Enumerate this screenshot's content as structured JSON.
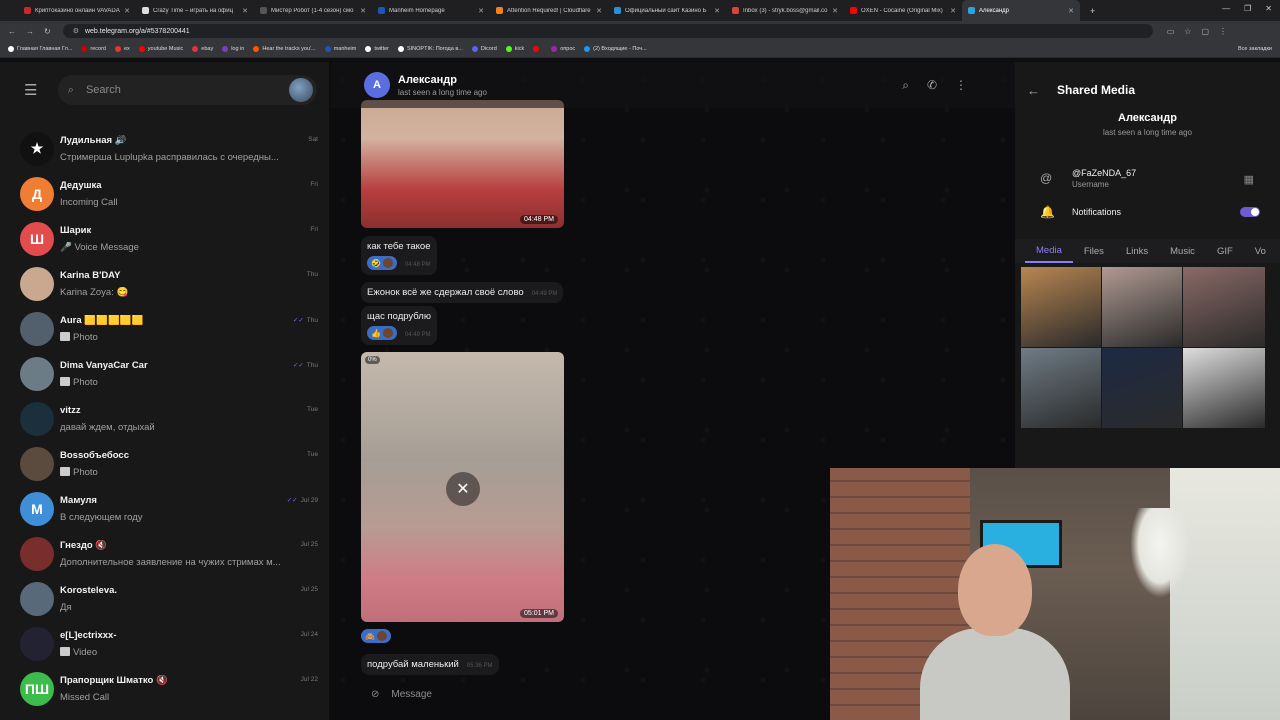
{
  "browser": {
    "tabs": [
      {
        "label": "Криптоказино онлайн VAVADA",
        "color": "#c82a2a"
      },
      {
        "label": "Crazy Time – играть на офиц",
        "color": "#ddd"
      },
      {
        "label": "Мистер Робот (1-4 сезон) смо",
        "color": "#555"
      },
      {
        "label": "Manheim Homepage",
        "color": "#1a57b8"
      },
      {
        "label": "Attention Required! | Cloudflare",
        "color": "#f48120"
      },
      {
        "label": "Официальный сайт Казино Б",
        "color": "#2c8fd6"
      },
      {
        "label": "Inbox (3) - stryk.boss@gmail.co",
        "color": "#d44638"
      },
      {
        "label": "OXEN - Cocaine (Original Mix)",
        "color": "#ff0000"
      },
      {
        "label": "Александр",
        "color": "#2aa3e0",
        "active": true
      }
    ],
    "url": "web.telegram.org/a/#5378200441",
    "bookmarks": [
      {
        "label": "Главная Главная Гл...",
        "color": "#fff"
      },
      {
        "label": "record",
        "color": "#c00"
      },
      {
        "label": "ex",
        "color": "#e33"
      },
      {
        "label": "youtube Music",
        "color": "#f00"
      },
      {
        "label": "ebay",
        "color": "#e53238"
      },
      {
        "label": "log in",
        "color": "#7b3fb8"
      },
      {
        "label": "Hear the tracks you'...",
        "color": "#f50"
      },
      {
        "label": "manheim",
        "color": "#1a57b8"
      },
      {
        "label": "twitter",
        "color": "#fff"
      },
      {
        "label": "SINOPTIK: Погода в...",
        "color": "#fff"
      },
      {
        "label": "Dicord",
        "color": "#5865f2"
      },
      {
        "label": "kick",
        "color": "#53fc18"
      },
      {
        "label": "",
        "color": "#f00"
      },
      {
        "label": "опрос",
        "color": "#9c27b0"
      },
      {
        "label": "(2) Входящие - Поч...",
        "color": "#2196f3"
      }
    ],
    "all_bookmarks": "Все закладки"
  },
  "sidebar": {
    "search_placeholder": "Search",
    "chats": [
      {
        "name": "Лудильная 🔊",
        "preview": "Стримерша Luplupka раcправилась с очередны...",
        "date": "Sat",
        "avatar_letter": "★",
        "avatar_color": "#111"
      },
      {
        "name": "Дедушка",
        "preview": "Incoming Call",
        "date": "Fri",
        "avatar_letter": "Д",
        "avatar_color": "#ef7d34"
      },
      {
        "name": "Шарик",
        "preview": "🎤 Voice Message",
        "date": "Fri",
        "avatar_letter": "Ш",
        "avatar_color": "#e24c4c"
      },
      {
        "name": "Karina B'DAY",
        "preview": "Karina Zoya: 😋",
        "date": "Thu",
        "avatar_letter": "",
        "avatar_color": "#c9a88f"
      },
      {
        "name": "Aura 🟨🟨🟨🟨🟨",
        "preview": "Photo",
        "date": "Thu",
        "avatar_letter": "",
        "avatar_color": "#52606d",
        "read": true
      },
      {
        "name": "Dima VanyaCar Car",
        "preview": "Photo",
        "date": "Thu",
        "avatar_letter": "",
        "avatar_color": "#6c7c86",
        "read": true
      },
      {
        "name": "vitzz",
        "preview": "давай ждем, отдыхай",
        "date": "Tue",
        "avatar_letter": "",
        "avatar_color": "#1c2f3c"
      },
      {
        "name": "Bossобъебосс",
        "preview": "Photo",
        "date": "Tue",
        "avatar_letter": "",
        "avatar_color": "#5b4a3e"
      },
      {
        "name": "Мамуля",
        "preview": "В следующем году",
        "date": "Jul 29",
        "avatar_letter": "М",
        "avatar_color": "#3f8fd8",
        "read": true
      },
      {
        "name": "Гнездо 🔇",
        "preview": "Дополнительное заявление на чужих стримах м...",
        "date": "Jul 25",
        "avatar_letter": "",
        "avatar_color": "#7a2d2d"
      },
      {
        "name": "Korosteleva.",
        "preview": "Дя",
        "date": "Jul 25",
        "avatar_letter": "",
        "avatar_color": "#586a7a"
      },
      {
        "name": "e[L]ectrixxx-",
        "preview": "Video",
        "date": "Jul 24",
        "avatar_letter": "",
        "avatar_color": "#223"
      },
      {
        "name": "Прапорщик Шматко 🔇",
        "preview": "Missed Call",
        "date": "Jul 22",
        "avatar_letter": "ПШ",
        "avatar_color": "#3dbb4c"
      }
    ]
  },
  "chat": {
    "name": "Александр",
    "status": "last seen a long time ago",
    "avatar_letter": "А",
    "photo1_time": "04:48 PM",
    "msg1": "как тебе такое",
    "msg1_time": "04:48 PM",
    "msg2": "Ежонок всё же сдержал своё слово",
    "msg2_time": "04:49 PM",
    "msg3": "щас подрублю",
    "msg3_time": "04:49 PM",
    "photo2_progress": "0%",
    "photo2_time": "05:01 PM",
    "msg4": "подрубай маленький",
    "msg4_time": "05:36 PM",
    "composer_placeholder": "Message"
  },
  "shared_media": {
    "title": "Shared Media",
    "name": "Александр",
    "status": "last seen a long time ago",
    "username": "@FaZeNDA_67",
    "username_label": "Username",
    "notifications_label": "Notifications",
    "notifications_on": true,
    "tabs": [
      "Media",
      "Files",
      "Links",
      "Music",
      "GIF",
      "Vo"
    ],
    "active_tab": "Media",
    "grid_colors": [
      "#b88652",
      "#b09a92",
      "#8a6a66",
      "#6f7c86",
      "#1d2a44",
      "#dedede"
    ]
  }
}
